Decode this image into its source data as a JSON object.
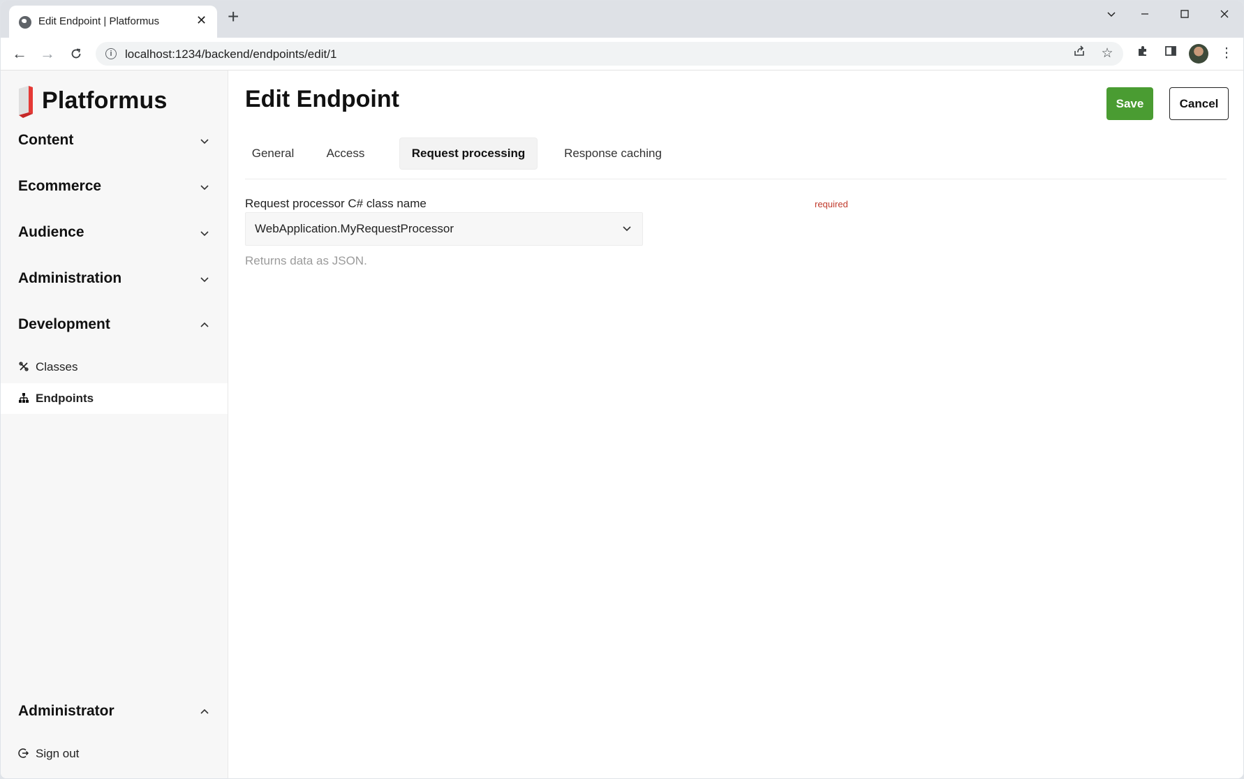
{
  "browser": {
    "tab_title": "Edit Endpoint | Platformus",
    "url": "localhost:1234/backend/endpoints/edit/1"
  },
  "brand": {
    "name": "Platformus",
    "accent": "#e53935"
  },
  "sidebar": {
    "groups": [
      {
        "label": "Content",
        "expanded": false
      },
      {
        "label": "Ecommerce",
        "expanded": false
      },
      {
        "label": "Audience",
        "expanded": false
      },
      {
        "label": "Administration",
        "expanded": false
      },
      {
        "label": "Development",
        "expanded": true,
        "items": [
          {
            "label": "Classes",
            "icon": "classes-icon",
            "active": false
          },
          {
            "label": "Endpoints",
            "icon": "endpoints-icon",
            "active": true
          }
        ]
      }
    ],
    "user": {
      "label": "Administrator",
      "expanded": true,
      "items": [
        {
          "label": "Sign out",
          "icon": "sign-out-icon"
        }
      ]
    }
  },
  "main": {
    "title": "Edit Endpoint",
    "save_label": "Save",
    "cancel_label": "Cancel",
    "save_color": "#4a9c32",
    "tabs": [
      {
        "label": "General",
        "active": false
      },
      {
        "label": "Access",
        "active": false
      },
      {
        "label": "Request processing",
        "active": true
      },
      {
        "label": "Response caching",
        "active": false
      }
    ],
    "field": {
      "label": "Request processor C# class name",
      "required_label": "required",
      "value": "WebApplication.MyRequestProcessor",
      "hint": "Returns data as JSON."
    }
  }
}
